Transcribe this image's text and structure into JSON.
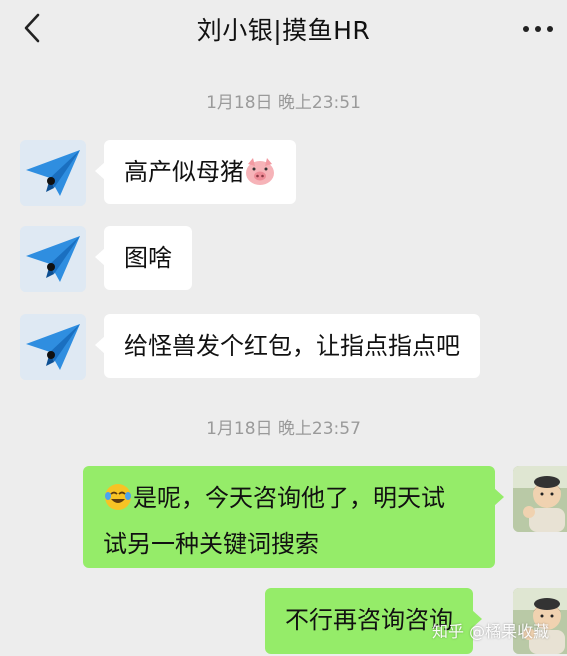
{
  "header": {
    "title": "刘小银|摸鱼HR"
  },
  "timestamps": [
    "1月18日 晚上23:51",
    "1月18日 晚上23:57"
  ],
  "messages": [
    {
      "side": "left",
      "text": "高产似母猪",
      "emoji": "pig-face-icon"
    },
    {
      "side": "left",
      "text": "图啥"
    },
    {
      "side": "left",
      "text": "给怪兽发个红包，让指点指点吧"
    },
    {
      "side": "right",
      "emoji": "crying-laughing-icon",
      "line1": "是呢，今天咨询他了，明天试",
      "line2": "试另一种关键词搜索"
    },
    {
      "side": "right",
      "text": "不行再咨询咨询"
    }
  ],
  "watermark": "知乎 @橘果收藏",
  "colors": {
    "background": "#ededed",
    "bubble_left": "#ffffff",
    "bubble_right": "#95ec69",
    "timestamp": "#9a9a9a"
  }
}
